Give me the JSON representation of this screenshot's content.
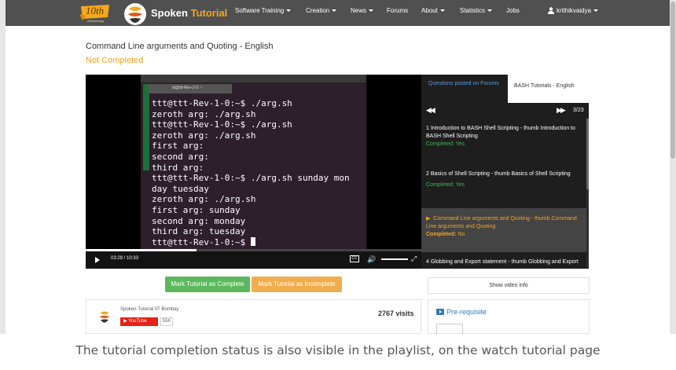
{
  "navbar": {
    "badge_text": "10th",
    "badge_subtext": "Anniversary",
    "brand_first": "Spoken",
    "brand_second": "Tutorial",
    "menu": [
      {
        "label": "Software Training",
        "dropdown": true
      },
      {
        "label": "Creation",
        "dropdown": true
      },
      {
        "label": "News",
        "dropdown": true
      },
      {
        "label": "Forums",
        "dropdown": false
      },
      {
        "label": "About",
        "dropdown": true
      },
      {
        "label": "Statistics",
        "dropdown": true
      },
      {
        "label": "Jobs",
        "dropdown": false
      }
    ],
    "user": "krithikvaidya",
    "colors": {
      "bar": "#505050",
      "accent": "#f4a81c"
    }
  },
  "page": {
    "title": "Command Line arguments and Quoting - English",
    "status": "Not Completed",
    "status_color": "#f0a422"
  },
  "video": {
    "terminal_tab": "ttt@ttt-Rev-1-0: ~",
    "terminal_lines": [
      "ttt@ttt-Rev-1-0:~$ ./arg.sh",
      "zeroth arg: ./arg.sh",
      "ttt@ttt-Rev-1-0:~$ ./arg.sh",
      "zeroth arg: ./arg.sh",
      "first arg:",
      "second arg:",
      "third arg:",
      "ttt@ttt-Rev-1-0:~$ ./arg.sh sunday mon",
      "day tuesday",
      "zeroth arg: ./arg.sh",
      "first arg: sunday",
      "second arg: monday",
      "third arg: tuesday",
      "ttt@ttt-Rev-1-0:~$ "
    ],
    "time_display": "03:29 / 10:33",
    "progress_fraction": 0.33,
    "cc_label": "CC"
  },
  "playlist": {
    "tab_questions": "Questions posted on Forums",
    "tab_series": "BASH Tutorials - English",
    "count": "3/23",
    "items": [
      {
        "title": "1   Introduction to BASH Shell Scripting - thumb Introduction to BASH Shell Scripting",
        "status_label": "Completed:",
        "status_value": "Yes",
        "active": false
      },
      {
        "title": "2   Basics of Shell Scripting - thumb   Basics of Shell Scripting",
        "status_label": "Completed:",
        "status_value": "Yes",
        "active": false
      },
      {
        "title": "Command Line arguments and Quoting - thumb Command Line arguments and Quoting",
        "status_label": "Completed:",
        "status_value": "No",
        "active": true
      },
      {
        "title": "4   Globbing and Export statement - thumb   Globbing and Export",
        "status_label": "",
        "status_value": "",
        "active": false
      }
    ]
  },
  "actions": {
    "mark_complete": "Mark Tutorial as Complete",
    "mark_incomplete": "Mark Tutorial as Incomplete",
    "show_video_info": "Show video info",
    "colors": {
      "complete": "#5cb85c",
      "incomplete": "#f0ad4e"
    }
  },
  "channel": {
    "name": "Spoken-Tutorial IIT Bombay",
    "youtube_label": "YouTube",
    "subscriber_count": "55K",
    "visits": "2767 visits"
  },
  "prerequisite": {
    "label": "Pre-requisite"
  },
  "caption": "The tutorial completion status is also visible in the playlist, on the watch tutorial page"
}
